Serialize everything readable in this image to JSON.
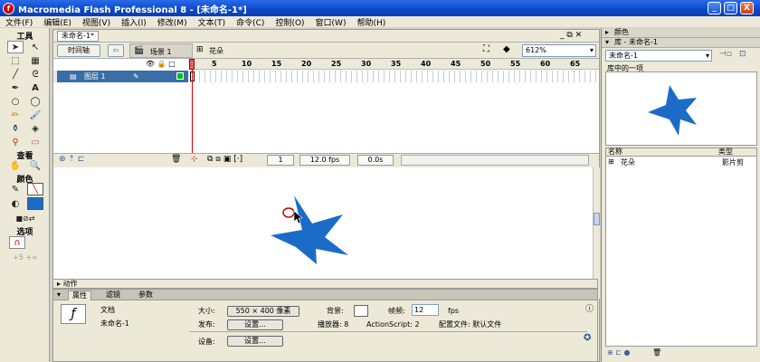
{
  "window": {
    "title": "Macromedia Flash Professional 8 - [未命名-1*]",
    "minimize": "_",
    "maximize": "□",
    "close": "X"
  },
  "menu": [
    "文件(F)",
    "编辑(E)",
    "视图(V)",
    "插入(I)",
    "修改(M)",
    "文本(T)",
    "命令(C)",
    "控制(O)",
    "窗口(W)",
    "帮助(H)"
  ],
  "toolbox": {
    "title": "工具",
    "view_title": "查看",
    "color_title": "颜色",
    "options_title": "选项"
  },
  "document": {
    "tab_label": "未命名-1*",
    "timeline_button": "时间轴",
    "scene_label": "场景 1",
    "symbol_label": "花朵",
    "zoom": "612%"
  },
  "timeline": {
    "frame_ticks": [
      "5",
      "10",
      "15",
      "20",
      "25",
      "30",
      "35",
      "40",
      "45",
      "50",
      "55",
      "60",
      "65"
    ],
    "layer_name": "图层 1",
    "current_frame": "1",
    "fps": "12.0 fps",
    "elapsed": "0.0s"
  },
  "panels": {
    "actions_label": "动作",
    "props_tabs": [
      "属性",
      "滤镜",
      "参数"
    ],
    "properties": {
      "doc_type": "文档",
      "doc_name": "未命名-1",
      "size_label": "大小:",
      "size_value": "550 × 400 像素",
      "bg_label": "背景:",
      "fps_label": "帧频:",
      "fps_value": "12",
      "fps_unit": "fps",
      "publish_label": "发布:",
      "settings_button": "设置...",
      "player_info": "播放器: 8",
      "actionscript_info": "ActionScript: 2",
      "profile_info": "配置文件: 默认文件",
      "device_label": "设备:",
      "device_button": "设置..."
    }
  },
  "right_panel": {
    "color_header": "颜色",
    "library_header": "库 - 未命名-1",
    "library_select": "未命名-1",
    "library_count": "库中的一项",
    "col_name": "名称",
    "col_type": "类型",
    "item_name": "花朵",
    "item_type": "影片剪"
  },
  "colors": {
    "star_fill": "#1a6cc8",
    "selection_blue": "#3a6ea5",
    "playhead": "#cc0000"
  }
}
